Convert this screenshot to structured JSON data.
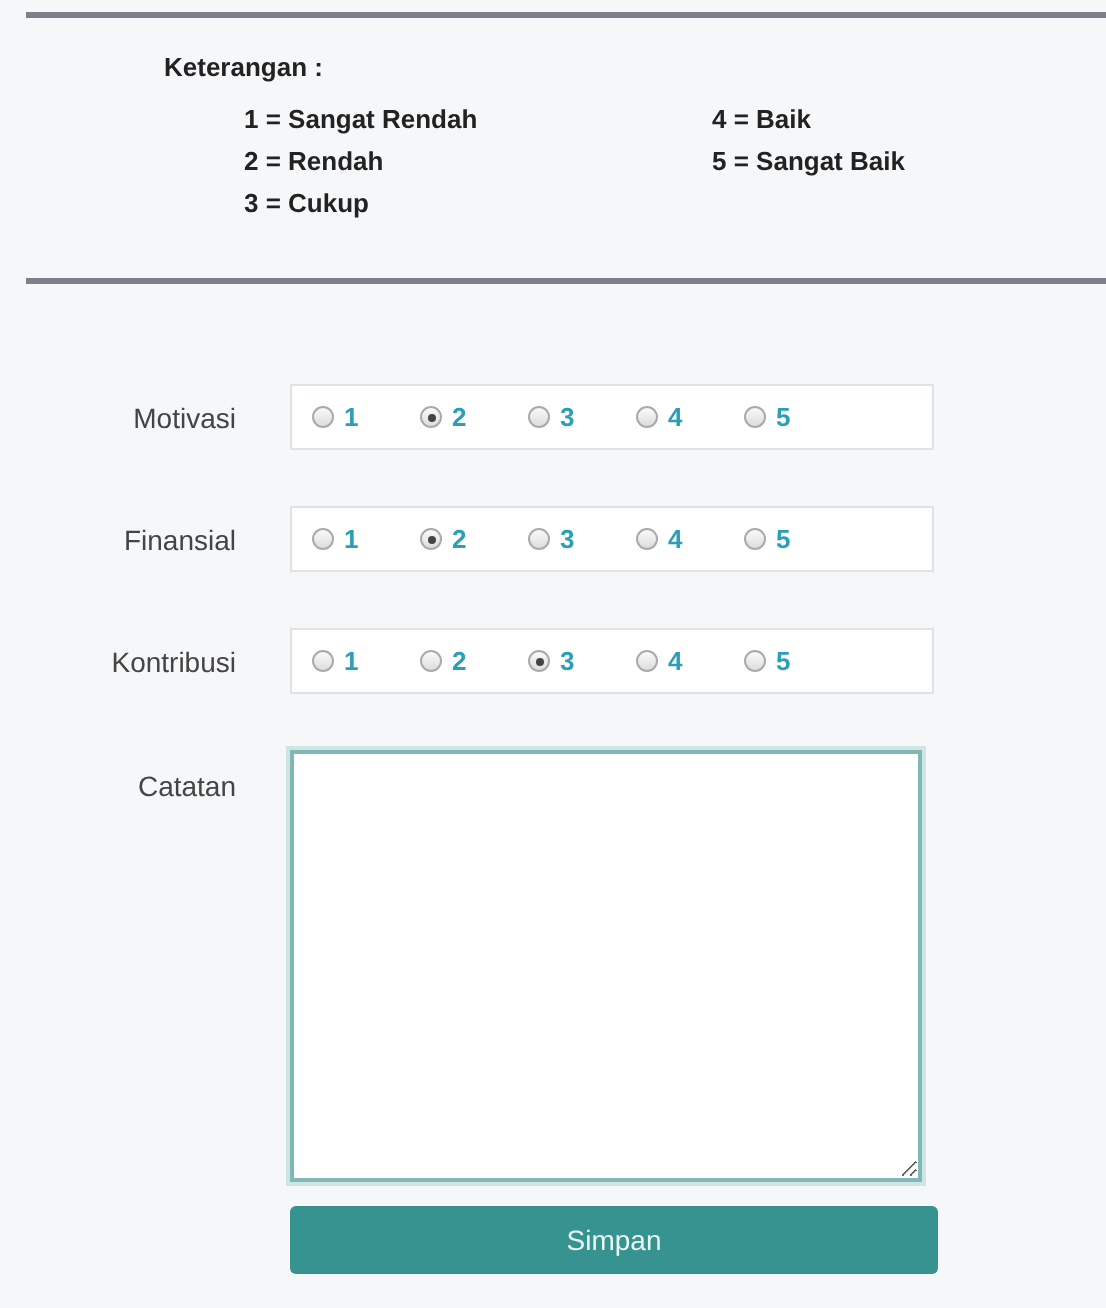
{
  "legend": {
    "title": "Keterangan :",
    "items": [
      "1 = Sangat Rendah",
      "2 = Rendah",
      "3 = Cukup",
      "4 = Baik",
      "5 = Sangat Baik"
    ]
  },
  "ratings": [
    {
      "label": "Motivasi",
      "options": [
        {
          "label": "1",
          "selected": false
        },
        {
          "label": "2",
          "selected": true
        },
        {
          "label": "3",
          "selected": false
        },
        {
          "label": "4",
          "selected": false
        },
        {
          "label": "5",
          "selected": false
        }
      ]
    },
    {
      "label": "Finansial",
      "options": [
        {
          "label": "1",
          "selected": false
        },
        {
          "label": "2",
          "selected": true
        },
        {
          "label": "3",
          "selected": false
        },
        {
          "label": "4",
          "selected": false
        },
        {
          "label": "5",
          "selected": false
        }
      ]
    },
    {
      "label": "Kontribusi",
      "options": [
        {
          "label": "1",
          "selected": false
        },
        {
          "label": "2",
          "selected": false
        },
        {
          "label": "3",
          "selected": true
        },
        {
          "label": "4",
          "selected": false
        },
        {
          "label": "5",
          "selected": false
        }
      ]
    }
  ],
  "notes": {
    "label": "Catatan"
  },
  "submit": "Simpan"
}
